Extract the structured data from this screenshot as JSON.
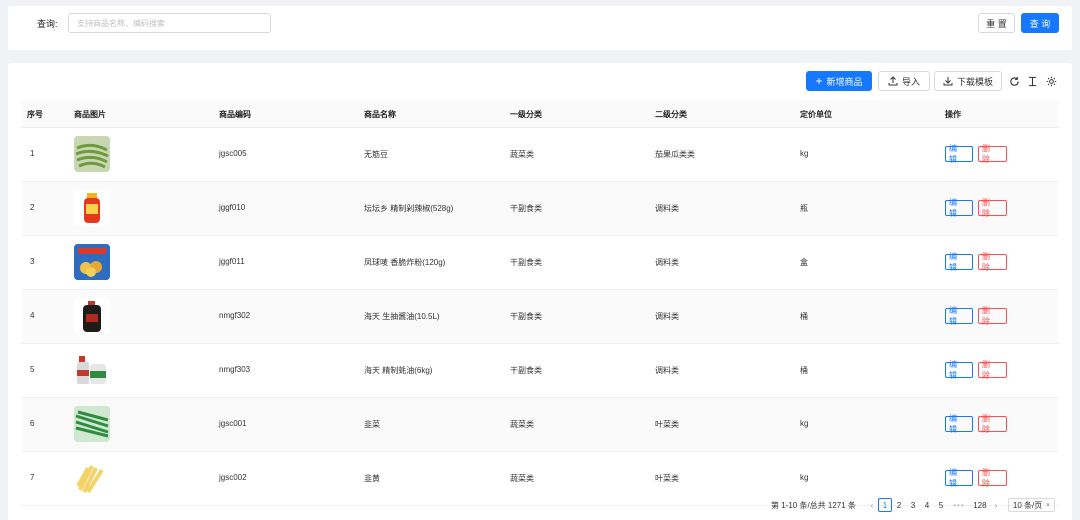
{
  "search": {
    "label": "查询:",
    "placeholder": "支持商品名称、编码搜索",
    "value": "",
    "reset_label": "重 置",
    "query_label": "查 询"
  },
  "toolbar": {
    "add_label": "新增商品",
    "import_label": "导入",
    "download_label": "下载模板",
    "icons": [
      "refresh-icon",
      "column-height-icon",
      "setting-icon"
    ]
  },
  "table": {
    "columns": [
      "序号",
      "商品图片",
      "商品编码",
      "商品名称",
      "一级分类",
      "二级分类",
      "定价单位",
      "操作"
    ],
    "edit_label": "编 辑",
    "delete_label": "删 除",
    "rows": [
      {
        "index": "1",
        "image": "green-beans",
        "code": "jgsc005",
        "name": "无筋豆",
        "cat1": "蔬菜类",
        "cat2": "茄果瓜类类",
        "unit": "kg"
      },
      {
        "index": "2",
        "image": "pickled-pepper-jar",
        "code": "jggf010",
        "name": "坛坛乡 精制剁辣椒(528g)",
        "cat1": "干副食类",
        "cat2": "调料类",
        "unit": "瓶"
      },
      {
        "index": "3",
        "image": "seasoning-box",
        "code": "jggf011",
        "name": "凤球唛 香脆炸粉(120g)",
        "cat1": "干副食类",
        "cat2": "调料类",
        "unit": "盒"
      },
      {
        "index": "4",
        "image": "soy-sauce-bottle",
        "code": "nmgf302",
        "name": "海天 生抽酱油(10.5L)",
        "cat1": "干副食类",
        "cat2": "调料类",
        "unit": "桶"
      },
      {
        "index": "5",
        "image": "oyster-sauce-bottles",
        "code": "nmgf303",
        "name": "海天 精制蚝油(6kg)",
        "cat1": "干副食类",
        "cat2": "调料类",
        "unit": "桶"
      },
      {
        "index": "6",
        "image": "chives",
        "code": "jgsc001",
        "name": "韭菜",
        "cat1": "蔬菜类",
        "cat2": "叶菜类",
        "unit": "kg"
      },
      {
        "index": "7",
        "image": "yellow-chives",
        "code": "jgsc002",
        "name": "韭黄",
        "cat1": "蔬菜类",
        "cat2": "叶菜类",
        "unit": "kg"
      }
    ]
  },
  "pagination": {
    "total_text": "第 1-10 条/总共 1271 条",
    "pages": [
      "1",
      "2",
      "3",
      "4",
      "5"
    ],
    "current_page": "1",
    "ellipsis": "•••",
    "last_page": "128",
    "page_size": "10 条/页"
  },
  "colors": {
    "primary": "#1677ff",
    "danger": "#ff4d4f",
    "background": "#f0f2f5"
  }
}
